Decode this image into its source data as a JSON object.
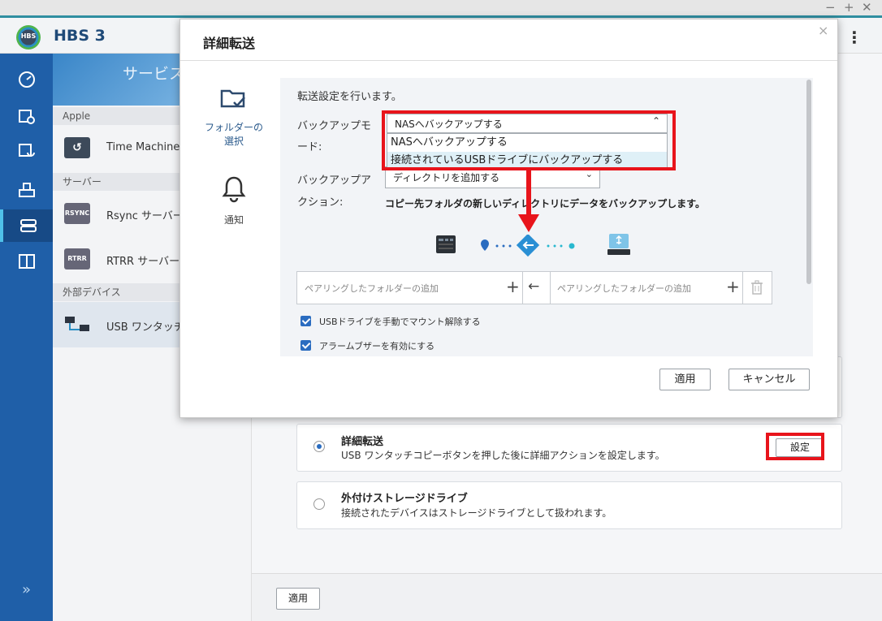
{
  "window": {
    "min": "−",
    "max": "+",
    "close": "✕"
  },
  "app": {
    "logo_text": "HBS",
    "title": "HBS 3",
    "menu_glyph": "⋮",
    "rail_expand": "»"
  },
  "sidebar": {
    "banner_title": "サービス",
    "groups": [
      {
        "label": "Apple"
      },
      {
        "label": "サーバー"
      },
      {
        "label": "外部デバイス"
      }
    ],
    "items": [
      {
        "label": "Time Machine",
        "icon_text": "↺"
      },
      {
        "label": "Rsync サーバー",
        "icon_text": "RSYNC"
      },
      {
        "label": "RTRR サーバー",
        "icon_text": "RTRR"
      },
      {
        "label": "USB ワンタッチ",
        "icon_text": ""
      }
    ]
  },
  "main": {
    "option_detail": {
      "title": "詳細転送",
      "desc": "USB ワンタッチコピーボタンを押した後に詳細アクションを設定します。",
      "button": "設定"
    },
    "option_storage": {
      "title": "外付けストレージドライブ",
      "desc": "接続されたデバイスはストレージドライブとして扱われます。"
    },
    "apply_button": "適用"
  },
  "modal": {
    "title": "詳細転送",
    "close": "×",
    "nav": [
      {
        "label_line1": "フォルダーの",
        "label_line2": "選択"
      },
      {
        "label": "通知"
      }
    ],
    "intro": "転送設定を行います。",
    "backup_mode": {
      "label_line1": "バックアップモ",
      "label_line2": "ード:",
      "selected": "NASへバックアップする",
      "options": [
        "NASへバックアップする",
        "接続されているUSBドライブにバックアップする"
      ]
    },
    "backup_action": {
      "label_line1": "バックアップア",
      "label_line2": "クション:",
      "selected": "ディレクトリを追加する",
      "description": "コピー先フォルダの新しいディレクトリにデータをバックアップします。"
    },
    "pairing": {
      "source_placeholder": "ペアリングしたフォルダーの追加",
      "dest_placeholder": "ペアリングしたフォルダーの追加",
      "add_glyph": "+",
      "arrow_glyph": "←"
    },
    "checkboxes": [
      {
        "label": "USBドライブを手動でマウント解除する",
        "checked": true
      },
      {
        "label": "アラームブザーを有効にする",
        "checked": true
      }
    ],
    "apply_button": "適用",
    "cancel_button": "キャンセル"
  },
  "colors": {
    "rail": "#1f5fa8",
    "highlight": "#e8141b",
    "accent": "#2a6cc0"
  }
}
